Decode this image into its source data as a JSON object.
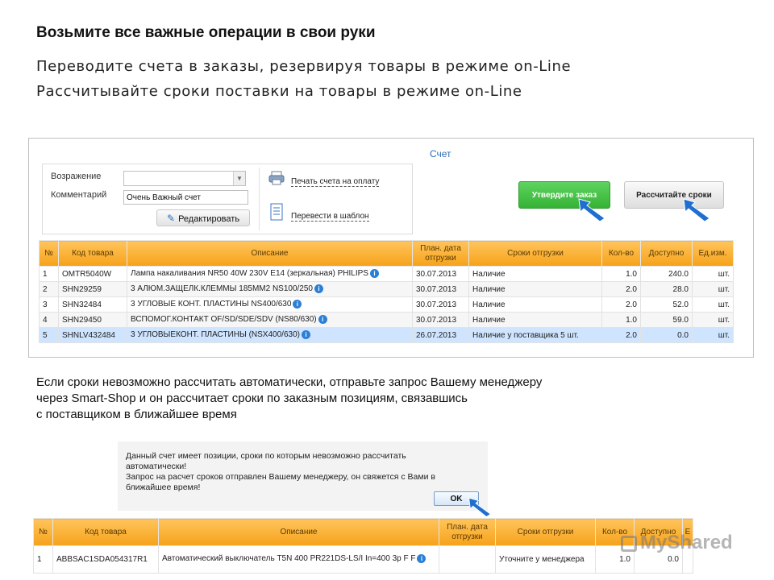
{
  "heading": "Возьмите все важные операции в свои руки",
  "subtitle": [
    "Переводите счета в заказы, резервируя товары в режиме on-Line",
    "Рассчитывайте сроки поставки на товары в режиме on-Line"
  ],
  "panel": {
    "title": "Счет",
    "labels": {
      "objection": "Возражение",
      "comment": "Комментарий"
    },
    "comment_value": "Очень Важный счет",
    "edit_button": "Редактировать",
    "print_link": "Печать счета на оплату",
    "template_link": "Перевести в шаблон",
    "approve_button": "Утвердите заказ",
    "calc_button": "Рассчитайте сроки"
  },
  "table": {
    "headers": [
      "№",
      "Код товара",
      "Описание",
      "План. дата отгрузки",
      "Сроки отгрузки",
      "Кол-во",
      "Доступно",
      "Ед.изм."
    ],
    "rows": [
      [
        "1",
        "OMTR5040W",
        "Лампа накаливания NR50 40W 230V E14 (зеркальная) PHILIPS",
        "30.07.2013",
        "Наличие",
        "1.0",
        "240.0",
        "шт."
      ],
      [
        "2",
        "SHN29259",
        "3 АЛЮМ.ЗАЩЕЛК.КЛЕММЫ 185ММ2 NS100/250",
        "30.07.2013",
        "Наличие",
        "2.0",
        "28.0",
        "шт."
      ],
      [
        "3",
        "SHN32484",
        "3 УГЛОВЫЕ КОНТ. ПЛАСТИНЫ NS400/630",
        "30.07.2013",
        "Наличие",
        "2.0",
        "52.0",
        "шт."
      ],
      [
        "4",
        "SHN29450",
        "ВСПОМОГ.КОНТАКТ OF/SD/SDE/SDV (NS80/630)",
        "30.07.2013",
        "Наличие",
        "1.0",
        "59.0",
        "шт."
      ],
      [
        "5",
        "SHNLV432484",
        "3 УГЛОВЫЕКОНТ. ПЛАСТИНЫ (NSX400/630)",
        "26.07.2013",
        "Наличие у поставщика 5 шт.",
        "2.0",
        "0.0",
        "шт."
      ]
    ]
  },
  "paragraph": [
    "Если сроки невозможно рассчитать автоматически, отправьте запрос Вашему менеджеру",
    "через Smart-Shop и он рассчитает сроки по заказным позициям, связавшись",
    "с поставщиком в ближайшее время"
  ],
  "dialog": {
    "lines": [
      "Данный счет имеет позиции, сроки по которым невозможно рассчитать",
      "автоматически!",
      "Запрос на расчет сроков отправлен Вашему менеджеру, он свяжется с Вами в",
      "ближайшее время!"
    ],
    "ok_button": "OK"
  },
  "table2": {
    "headers": [
      "№",
      "Код товара",
      "Описание",
      "План. дата отгрузки",
      "Сроки отгрузки",
      "Кол-во",
      "Доступно",
      "Е"
    ],
    "row": [
      "1",
      "ABBSAC1SDA054317R1",
      "Автоматический выключатель T5N 400 PR221DS-LS/I In=400 3p F F",
      "",
      "Уточните у менеджера",
      "1.0",
      "0.0",
      ""
    ]
  },
  "watermark": "MyShared",
  "colors": {
    "header_orange": "#f6a21a",
    "approve_green": "#3cb93c",
    "selected_row": "#cfe4ff",
    "arrow_blue": "#1f6fd1"
  }
}
